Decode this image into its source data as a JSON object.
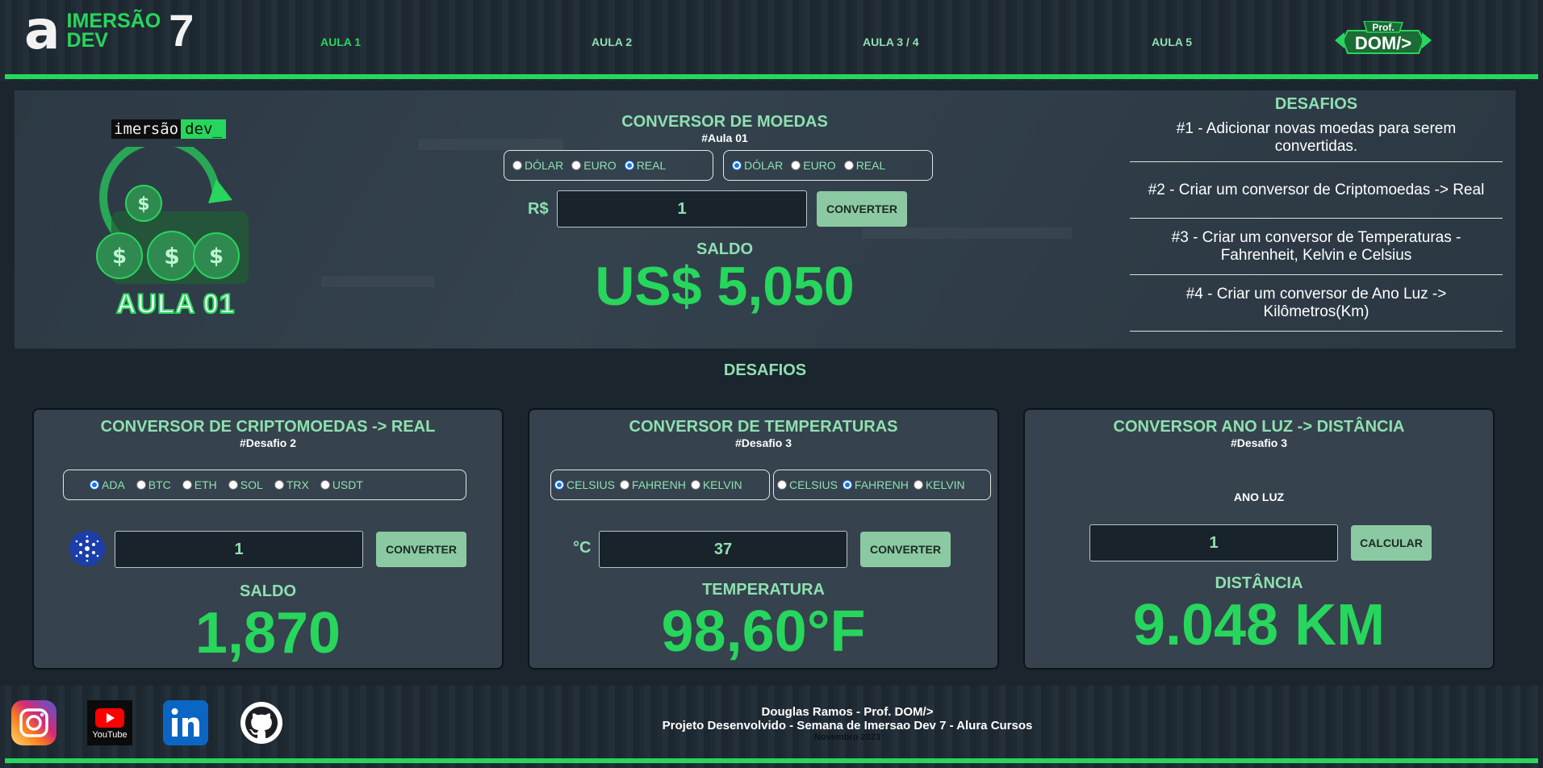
{
  "header": {
    "logo_text_line1": "IMERSÃO",
    "logo_text_line2": "DEV",
    "logo_number": "7",
    "nav": [
      "AULA 1",
      "AULA 2",
      "AULA 3 / 4",
      "AULA 5"
    ],
    "badge_top": "Prof.",
    "badge_main": "DOM/>"
  },
  "hero": {
    "tag_left": "imersão",
    "tag_right": "dev_",
    "aula_label": "AULA 01"
  },
  "converter": {
    "title": "CONVERSOR DE MOEDAS",
    "subtitle": "#Aula 01",
    "from_options": [
      {
        "label": "DÓLAR",
        "selected": false
      },
      {
        "label": "EURO",
        "selected": false
      },
      {
        "label": "REAL",
        "selected": true
      }
    ],
    "to_options": [
      {
        "label": "DÓLAR",
        "selected": true
      },
      {
        "label": "EURO",
        "selected": false
      },
      {
        "label": "REAL",
        "selected": false
      }
    ],
    "currency_prefix": "R$",
    "input_value": "1",
    "button_label": "CONVERTER",
    "result_label": "SALDO",
    "result_value": "US$ 5,050"
  },
  "desafios_panel": {
    "title": "DESAFIOS",
    "items": [
      "#1 - Adicionar novas moedas para serem convertidas.",
      "#2 - Criar um conversor de Criptomoedas -> Real",
      "#3 - Criar um conversor de Temperaturas - Fahrenheit, Kelvin e Celsius",
      "#4 - Criar um conversor de Ano Luz -> Kilômetros(Km)"
    ]
  },
  "desafios_heading": "DESAFIOS",
  "crypto_card": {
    "title": "CONVERSOR DE CRIPTOMOEDAS -> REAL",
    "subtitle": "#Desafio 2",
    "options": [
      {
        "label": "ADA",
        "selected": true
      },
      {
        "label": "BTC",
        "selected": false
      },
      {
        "label": "ETH",
        "selected": false
      },
      {
        "label": "SOL",
        "selected": false
      },
      {
        "label": "TRX",
        "selected": false
      },
      {
        "label": "USDT",
        "selected": false
      }
    ],
    "input_value": "1",
    "button_label": "CONVERTER",
    "result_label": "SALDO",
    "result_value": "1,870"
  },
  "temp_card": {
    "title": "CONVERSOR DE TEMPERATURAS",
    "subtitle": "#Desafio 3",
    "from_options": [
      {
        "label": "CELSIUS",
        "selected": true
      },
      {
        "label": "FAHRENH",
        "selected": false
      },
      {
        "label": "KELVIN",
        "selected": false
      }
    ],
    "to_options": [
      {
        "label": "CELSIUS",
        "selected": false
      },
      {
        "label": "FAHRENH",
        "selected": true
      },
      {
        "label": "KELVIN",
        "selected": false
      }
    ],
    "unit_prefix": "°C",
    "input_value": "37",
    "button_label": "CONVERTER",
    "result_label": "TEMPERATURA",
    "result_value": "98,60°F"
  },
  "lightyear_card": {
    "title": "CONVERSOR ANO LUZ -> DISTÂNCIA",
    "subtitle": "#Desafio 3",
    "input_label": "ANO LUZ",
    "input_value": "1",
    "button_label": "CALCULAR",
    "result_label": "DISTÂNCIA",
    "result_value": "9.048 KM"
  },
  "footer": {
    "youtube_label": "YouTube",
    "line1": "Douglas Ramos - Prof. DOM/>",
    "line2": "Projeto Desenvolvido - Semana de Imersao Dev 7 - Alura Cursos",
    "line3": "Novembro 2023"
  },
  "colors": {
    "accent_green": "#27d65c",
    "soft_green": "#8ee0b0",
    "button_bg": "#8bc9a2",
    "panel_bg": "#36424d",
    "page_bg": "#1b252e"
  }
}
